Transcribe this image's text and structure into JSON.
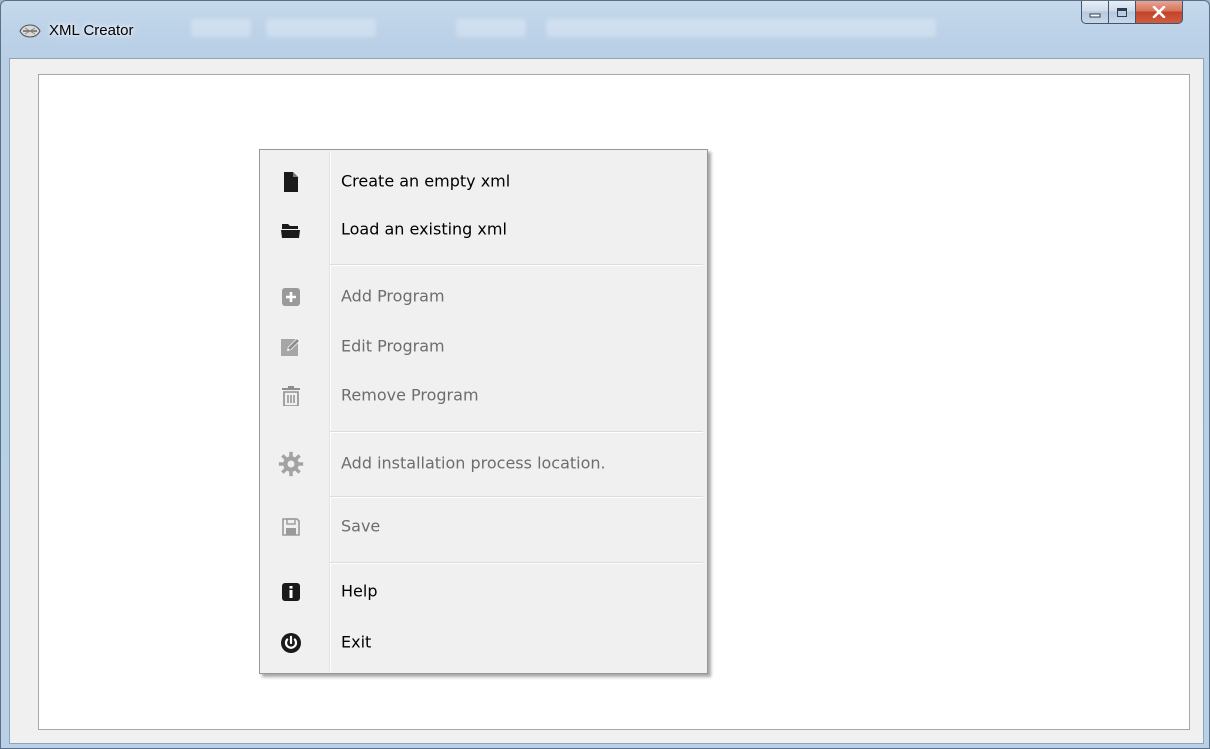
{
  "window": {
    "title": "XML Creator",
    "controls": {
      "minimize_icon": "minimize-icon",
      "maximize_icon": "maximize-icon",
      "close_icon": "close-icon"
    }
  },
  "menu": {
    "items": [
      {
        "label": "Create an empty xml",
        "icon": "new-file-icon",
        "enabled": true
      },
      {
        "label": "Load an existing xml",
        "icon": "open-folder-icon",
        "enabled": true
      },
      {
        "label": "Add Program",
        "icon": "plus-square-icon",
        "enabled": false
      },
      {
        "label": "Edit Program",
        "icon": "edit-pencil-icon",
        "enabled": false
      },
      {
        "label": "Remove Program",
        "icon": "trash-icon",
        "enabled": false
      },
      {
        "label": "Add installation process location.",
        "icon": "gears-icon",
        "enabled": false
      },
      {
        "label": "Save",
        "icon": "floppy-disk-icon",
        "enabled": false
      },
      {
        "label": "Help",
        "icon": "info-icon",
        "enabled": true
      },
      {
        "label": "Exit",
        "icon": "power-icon",
        "enabled": true
      }
    ]
  },
  "colors": {
    "menu_background": "#f0f0f0",
    "enabled_text": "#000000",
    "disabled_text": "#6d6d6d",
    "enabled_icon": "#1a1a1a",
    "disabled_icon": "#9a9a9a"
  }
}
